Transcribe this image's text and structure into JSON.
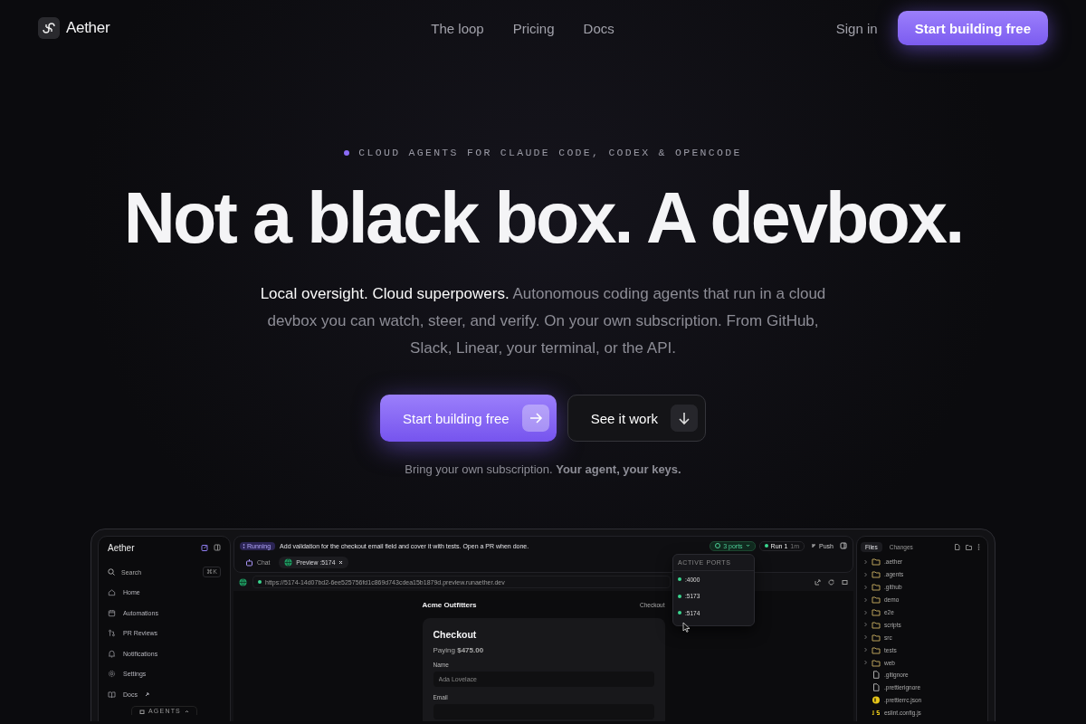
{
  "nav": {
    "brand": "Aether",
    "links": [
      "The loop",
      "Pricing",
      "Docs"
    ],
    "sign_in": "Sign in",
    "cta": "Start building free"
  },
  "hero": {
    "eyebrow": "CLOUD AGENTS FOR CLAUDE CODE, CODEX & OPENCODE",
    "headline": "Not a black box. A devbox.",
    "lead": "**Local oversight. Cloud superpowers.** Autonomous coding agents that run in a cloud devbox you can watch, steer, and verify. On your own subscription. From GitHub, Slack, Linear, your terminal, or the API.",
    "primary_button": "Start building free",
    "secondary_button": "See it work",
    "note": "Bring your own subscription. **Your agent, your keys.**"
  },
  "app": {
    "sidebar": {
      "brand": "Aether",
      "search": "Search",
      "shortcut": "⌘K",
      "items": [
        {
          "label": "Home",
          "external": false
        },
        {
          "label": "Automations",
          "external": false
        },
        {
          "label": "PR Reviews",
          "external": false
        },
        {
          "label": "Notifications",
          "external": false
        },
        {
          "label": "Settings",
          "external": false
        },
        {
          "label": "Docs",
          "external": true
        }
      ],
      "section": "AGENTS"
    },
    "task": {
      "status": "Running",
      "text": "Add validation for the checkout email field and cover it with tests. Open a PR when done."
    },
    "toolbar": {
      "ports": "3 ports",
      "run": "Run 1",
      "run_time": "1m",
      "push": "Push"
    },
    "tabs": [
      {
        "label": "Chat",
        "kind": "chat",
        "selected": false,
        "closable": false
      },
      {
        "label": "Preview :5174",
        "kind": "preview",
        "selected": true,
        "closable": true
      }
    ],
    "url": "https://5174-14d07bd2-6ee525756fd1c869d743cdea15b1879d.preview.runaether.dev",
    "preview": {
      "store": "Acme Outfitters",
      "nav_link": "Checkout",
      "title": "Checkout",
      "amount": "Paying **$475.00**",
      "fields": [
        {
          "label": "Name",
          "value": "Ada Lovelace"
        },
        {
          "label": "Email"
        }
      ]
    },
    "ports_menu": {
      "title": "ACTIVE PORTS",
      "ports": [
        ":4000",
        ":5173",
        ":5174"
      ]
    },
    "files": {
      "tabs": [
        {
          "label": "Files",
          "selected": true
        },
        {
          "label": "Changes",
          "selected": false
        }
      ],
      "tree": [
        {
          "name": ".aether",
          "kind": "folder",
          "expanded": false
        },
        {
          "name": ".agents",
          "kind": "folder",
          "expanded": false
        },
        {
          "name": ".github",
          "kind": "folder",
          "expanded": false
        },
        {
          "name": "demo",
          "kind": "folder",
          "expanded": false
        },
        {
          "name": "e2e",
          "kind": "folder",
          "expanded": false
        },
        {
          "name": "scripts",
          "kind": "folder",
          "expanded": false
        },
        {
          "name": "src",
          "kind": "folder",
          "expanded": false
        },
        {
          "name": "tests",
          "kind": "folder",
          "expanded": false
        },
        {
          "name": "web",
          "kind": "folder",
          "expanded": false
        },
        {
          "name": ".gitignore",
          "kind": "file"
        },
        {
          "name": ".prettierignore",
          "kind": "file"
        },
        {
          "name": ".prettierrc.json",
          "kind": "json"
        },
        {
          "name": "eslint.config.js",
          "kind": "js"
        }
      ]
    }
  }
}
